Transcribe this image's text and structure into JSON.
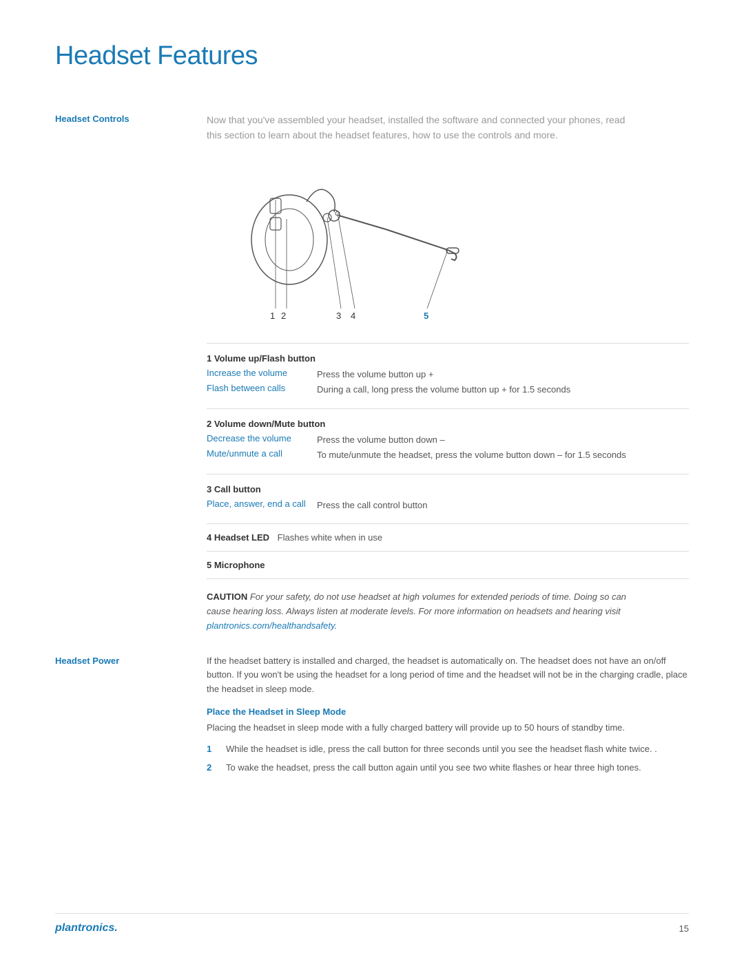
{
  "page": {
    "title": "Headset Features",
    "page_number": "15"
  },
  "headset_controls": {
    "label": "Headset Controls",
    "intro": "Now that you've assembled your headset, installed the software and connected your phones, read this section to learn about the headset features, how to use the controls and more."
  },
  "controls": [
    {
      "number": "1",
      "title": "Volume up/Flash button",
      "rows": [
        {
          "action": "Increase the volume",
          "desc": "Press the volume button up +"
        },
        {
          "action": "Flash between calls",
          "desc": "During a call, long press the volume button up + for 1.5 seconds"
        }
      ]
    },
    {
      "number": "2",
      "title": "Volume down/Mute button",
      "rows": [
        {
          "action": "Decrease the volume",
          "desc": "Press the volume button down –"
        },
        {
          "action": "Mute/unmute a call",
          "desc": "To mute/unmute the headset, press the volume button down – for 1.5 seconds"
        }
      ]
    },
    {
      "number": "3",
      "title": "Call button",
      "rows": [
        {
          "action": "Place, answer, end a call",
          "desc": "Press the call control button"
        }
      ]
    },
    {
      "number": "4",
      "title": "Headset LED",
      "simple": true,
      "simple_desc": "Flashes white when in use"
    },
    {
      "number": "5",
      "title": "Microphone",
      "simple": true,
      "simple_desc": ""
    }
  ],
  "caution": {
    "label": "CAUTION",
    "text": "For your safety, do not use headset at high volumes for extended periods of time. Doing so can cause hearing loss. Always listen at moderate levels. For more information on headsets and hearing visit",
    "link": "plantronics.com/healthandsafety",
    "text_end": "."
  },
  "headset_power": {
    "label": "Headset Power",
    "intro": "If the headset battery is installed and charged, the headset is automatically on. The headset does not have an on/off button. If you won't be using the headset for a long period of time and the headset will not be in the charging cradle, place the headset in sleep mode.",
    "sleep_mode_title": "Place the Headset in Sleep Mode",
    "sleep_desc": "Placing the headset in sleep mode with a fully charged battery will provide up to 50 hours of standby time.",
    "steps": [
      "While the headset is idle, press the call button for three seconds until you see the headset flash white twice. .",
      "To wake the headset, press the call button again until you see two white flashes or hear three high tones."
    ]
  },
  "footer": {
    "brand": "plantronics.",
    "page": "15"
  },
  "diagram": {
    "labels": [
      "1",
      "2",
      "3",
      "4",
      "5"
    ]
  }
}
